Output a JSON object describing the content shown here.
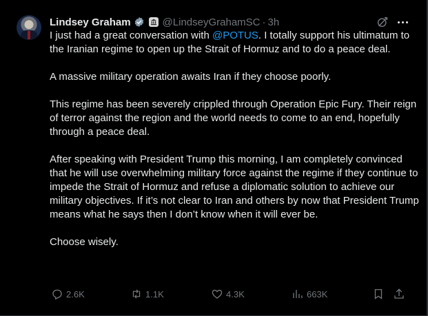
{
  "author": {
    "name": "Lindsey Graham",
    "handle": "@LindseyGrahamSC",
    "separator": "·",
    "time": "3h"
  },
  "tweet": {
    "line1_before": "I just had a great conversation with ",
    "mention": "@POTUS",
    "line1_after": ". I totally support his ultimatum to the Iranian regime to open up the Strait of Hormuz and to do a peace deal.",
    "para2": "A massive military operation awaits Iran if they choose poorly.",
    "para3": "This regime has been severely crippled through Operation Epic Fury. Their reign of terror against the region and the world needs to come to an end, hopefully through a peace deal.",
    "para4": "After speaking with President Trump this morning, I am completely convinced that he will use overwhelming military force against the regime if they continue to impede the Strait of Hormuz and refuse a diplomatic solution to achieve our military objectives. If it’s not clear to Iran and others by now that President Trump means what he says then I don’t know when it will ever be.",
    "para5": "Choose wisely."
  },
  "actions": {
    "replies": "2.6K",
    "reposts": "1.1K",
    "likes": "4.3K",
    "views": "663K"
  },
  "icons": [
    "verified-badge-icon",
    "government-affiliation-icon",
    "grok-icon",
    "more-icon",
    "reply-icon",
    "repost-icon",
    "like-icon",
    "views-icon",
    "bookmark-icon",
    "share-icon"
  ],
  "colors": {
    "background": "#000000",
    "text": "#e7e9ea",
    "muted": "#71767b",
    "accent": "#1d9bf0"
  }
}
